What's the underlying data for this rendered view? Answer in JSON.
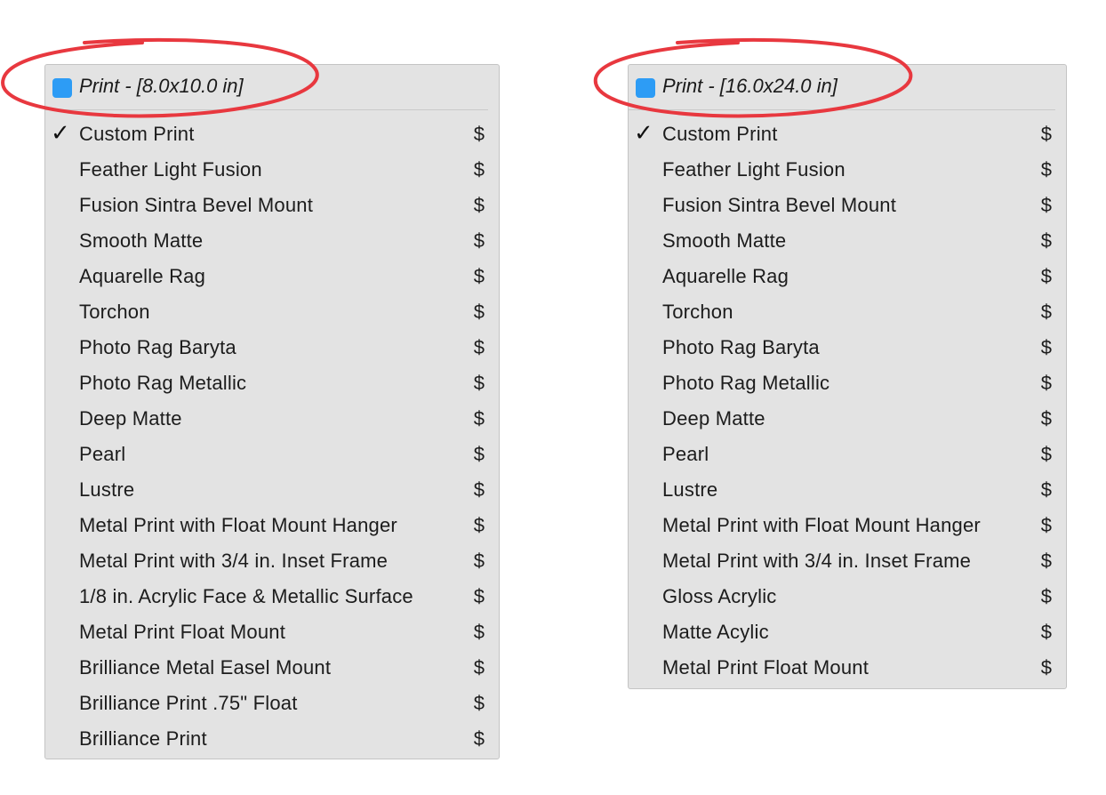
{
  "colors": {
    "swatch": "#2d9cf5",
    "annotation": "#e8383f",
    "menu_bg": "#e3e3e3"
  },
  "menus": [
    {
      "title": "Print - [8.0x10.0 in]",
      "items": [
        {
          "label": "Custom Print",
          "price": "$",
          "checked": true
        },
        {
          "label": "Feather Light Fusion",
          "price": "$"
        },
        {
          "label": "Fusion Sintra Bevel Mount",
          "price": "$"
        },
        {
          "label": "Smooth Matte",
          "price": "$"
        },
        {
          "label": "Aquarelle Rag",
          "price": "$"
        },
        {
          "label": "Torchon",
          "price": "$"
        },
        {
          "label": "Photo Rag Baryta",
          "price": "$"
        },
        {
          "label": "Photo Rag Metallic",
          "price": "$"
        },
        {
          "label": "Deep Matte",
          "price": "$"
        },
        {
          "label": "Pearl",
          "price": "$"
        },
        {
          "label": "Lustre",
          "price": "$"
        },
        {
          "label": "Metal Print with Float Mount Hanger",
          "price": "$"
        },
        {
          "label": "Metal Print with 3/4 in. Inset Frame",
          "price": "$"
        },
        {
          "label": "1/8 in. Acrylic Face & Metallic Surface",
          "price": "$"
        },
        {
          "label": "Metal Print Float Mount",
          "price": "$"
        },
        {
          "label": "Brilliance Metal Easel Mount",
          "price": "$"
        },
        {
          "label": "Brilliance Print .75\" Float",
          "price": "$"
        },
        {
          "label": "Brilliance Print",
          "price": "$"
        }
      ]
    },
    {
      "title": "Print - [16.0x24.0 in]",
      "items": [
        {
          "label": "Custom Print",
          "price": "$",
          "checked": true
        },
        {
          "label": "Feather Light Fusion",
          "price": "$"
        },
        {
          "label": "Fusion Sintra Bevel Mount",
          "price": "$"
        },
        {
          "label": "Smooth Matte",
          "price": "$"
        },
        {
          "label": "Aquarelle Rag",
          "price": "$"
        },
        {
          "label": "Torchon",
          "price": "$"
        },
        {
          "label": "Photo Rag Baryta",
          "price": "$"
        },
        {
          "label": "Photo Rag Metallic",
          "price": "$"
        },
        {
          "label": "Deep Matte",
          "price": "$"
        },
        {
          "label": "Pearl",
          "price": "$"
        },
        {
          "label": "Lustre",
          "price": "$"
        },
        {
          "label": "Metal Print with Float Mount Hanger",
          "price": "$"
        },
        {
          "label": "Metal Print with 3/4 in. Inset Frame",
          "price": "$"
        },
        {
          "label": "Gloss Acrylic",
          "price": "$"
        },
        {
          "label": "Matte Acylic",
          "price": "$"
        },
        {
          "label": "Metal Print Float Mount",
          "price": "$"
        }
      ]
    }
  ]
}
